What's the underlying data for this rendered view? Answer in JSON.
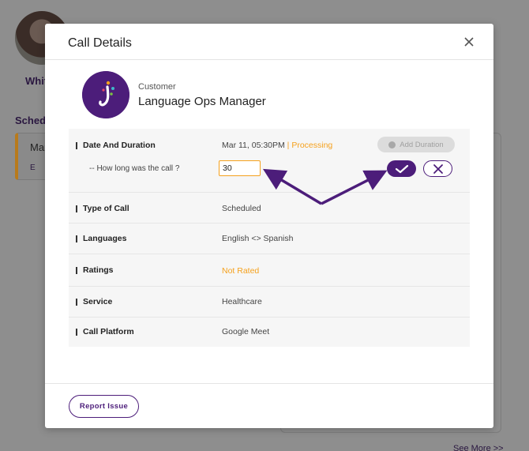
{
  "background": {
    "user_name": "Whit",
    "section_title": "Sched",
    "card_title": "Mar",
    "card_sub": "E",
    "see_more": "See More >>"
  },
  "modal": {
    "title": "Call Details",
    "customer_label": "Customer",
    "customer_name": "Language Ops Manager",
    "date_duration": {
      "label": "Date And Duration",
      "date": "Mar 11, 05:30PM",
      "separator": " | ",
      "status": "Processing",
      "add_duration_label": "Add Duration",
      "question": "-- How long was the call ?",
      "duration_value": "30"
    },
    "rows": [
      {
        "label": "Type of Call",
        "value": "Scheduled"
      },
      {
        "label": "Languages",
        "value": "English <> Spanish"
      },
      {
        "label": "Ratings",
        "value": "Not Rated"
      },
      {
        "label": "Service",
        "value": "Healthcare"
      },
      {
        "label": "Call Platform",
        "value": "Google Meet"
      }
    ],
    "report_issue_label": "Report Issue"
  },
  "colors": {
    "brand_purple": "#4c1d7a",
    "status_orange": "#f5a11d",
    "annotation_arrow": "#4c1d7a"
  }
}
